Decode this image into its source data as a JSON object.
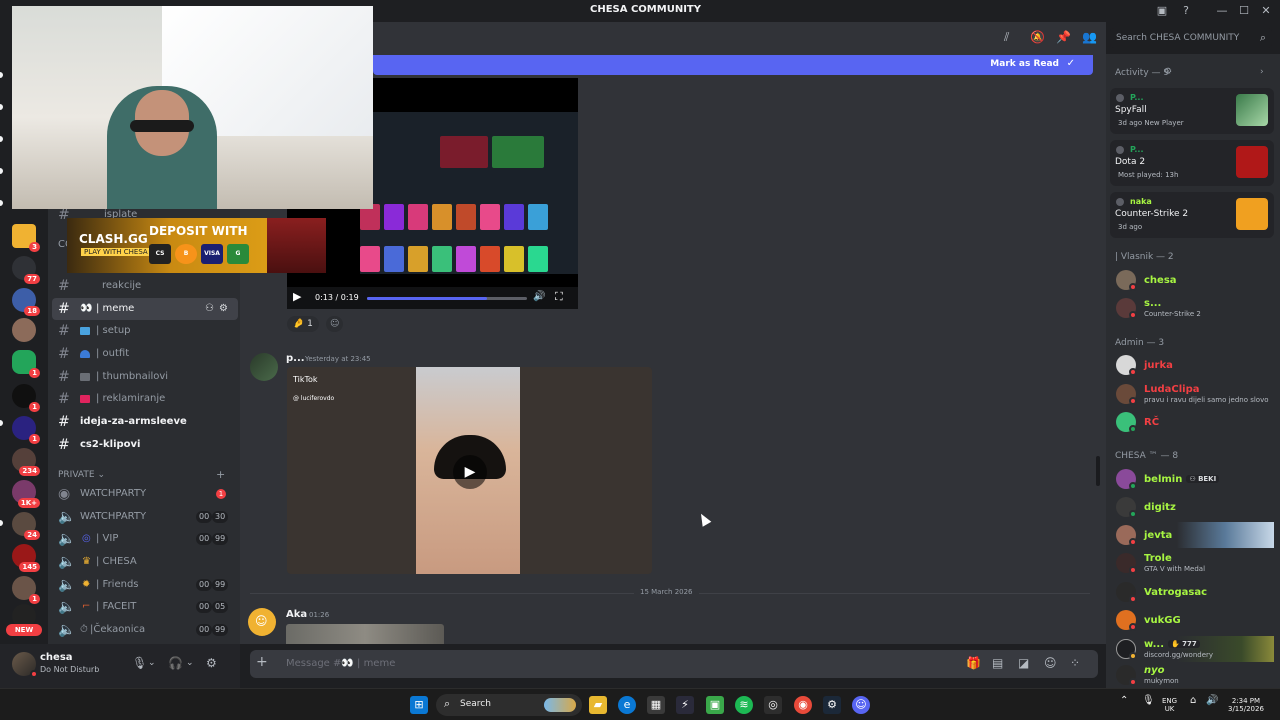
{
  "window": {
    "title": "CHESA COMMUNITY"
  },
  "servers": [
    {
      "badge": "3"
    },
    {
      "badge": "77"
    },
    {
      "badge": "18"
    },
    {
      "badge": ""
    },
    {
      "badge": "1"
    },
    {
      "badge": "1"
    },
    {
      "badge": "234"
    },
    {
      "badge": "1K+"
    },
    {
      "badge": "24"
    },
    {
      "badge": "145"
    },
    {
      "badge": "1"
    }
  ],
  "rail_new_label": "NEW",
  "channels": [
    {
      "name": "isplate"
    },
    {
      "name": "CO"
    },
    {
      "name": "reakcije"
    },
    {
      "name": "| meme"
    },
    {
      "name": "| setup"
    },
    {
      "name": "| outfit"
    },
    {
      "name": "| thumbnailovi"
    },
    {
      "name": "| reklamiranje"
    },
    {
      "name": "ideja-za-armsleeve"
    },
    {
      "name": "cs2-klipovi"
    }
  ],
  "private_category": "PRIVATE",
  "voice_channels": [
    {
      "name": "WATCHPARTY",
      "badge": "1"
    },
    {
      "name": "WATCHPARTY",
      "a": "00",
      "b": "30"
    },
    {
      "name": "| VIP",
      "a": "00",
      "b": "99"
    },
    {
      "name": "| CHESA"
    },
    {
      "name": "| Friends",
      "a": "00",
      "b": "99"
    },
    {
      "name": "| FACEIT",
      "a": "00",
      "b": "05"
    },
    {
      "name": "|Čekaonica",
      "a": "00",
      "b": "99"
    }
  ],
  "user": {
    "name": "chesa",
    "status": "Do Not Disturb"
  },
  "search": {
    "placeholder": "Search CHESA COMMUNITY"
  },
  "banner": {
    "mark_read": "Mark as Read"
  },
  "ad": {
    "brand": "CLASH.GG",
    "cta": "DEPOSIT WITH",
    "sub": "PLAY WITH CHESA",
    "pay1": "CS",
    "pay2": "B",
    "pay3": "VISA",
    "pay4": "G"
  },
  "video1": {
    "time": "0:13 / 0:19",
    "progress": 0.75
  },
  "reactions": {
    "count": "1"
  },
  "message2": {
    "author": "p...",
    "time": "Yesterday at 23:45",
    "tiktok": "TikTok",
    "tiktok_user": "@ luciferovdo"
  },
  "date_divider": "15 March 2026",
  "message3": {
    "author": "Aka",
    "time": "01:26"
  },
  "composer": {
    "placeholder": "Message #👀 | meme"
  },
  "members": {
    "activity_header": "Activity — 9",
    "activities": [
      {
        "who": "P...",
        "game": "SpyFall",
        "sub": "3d ago   New Player"
      },
      {
        "who": "P...",
        "game": "Dota 2",
        "sub": "Most played: 13h"
      },
      {
        "who": "naka",
        "game": "Counter-Strike 2",
        "sub": "3d ago"
      }
    ],
    "group1": "| Vlasnik — 2",
    "vlasnik": [
      {
        "name": "chesa",
        "sub": ""
      },
      {
        "name": "s...",
        "sub": "Counter-Strike 2"
      }
    ],
    "group2": "Admin — 3",
    "admins": [
      {
        "name": "jurka",
        "sub": ""
      },
      {
        "name": "LudaClipa",
        "sub": "pravu i ravu dijeli samo jedno slovo"
      },
      {
        "name": "RČ",
        "sub": ""
      }
    ],
    "group3": "CHESA ™ — 8",
    "chesa_members": [
      {
        "name": "belmin",
        "tag": "BEKI",
        "sub": ""
      },
      {
        "name": "digitz",
        "sub": ""
      },
      {
        "name": "jevta",
        "sub": ""
      },
      {
        "name": "Trole",
        "sub": "GTA V with Medal"
      },
      {
        "name": "Vatrogasac",
        "sub": ""
      },
      {
        "name": "vukGG",
        "sub": ""
      },
      {
        "name": "w...",
        "tag": "777",
        "sub": "discord.gg/wondery"
      },
      {
        "name": "nyo",
        "sub": "mukymon"
      }
    ]
  },
  "taskbar": {
    "search": "Search",
    "lang1": "ENG",
    "lang2": "UK",
    "time": "2:34 PM",
    "date": "3/15/2026"
  },
  "colors": {
    "accent": "#5865f2",
    "online": "#23a55a",
    "dnd": "#f23f43",
    "admin_name": "#f23f43",
    "member_name": "#a7f542"
  }
}
